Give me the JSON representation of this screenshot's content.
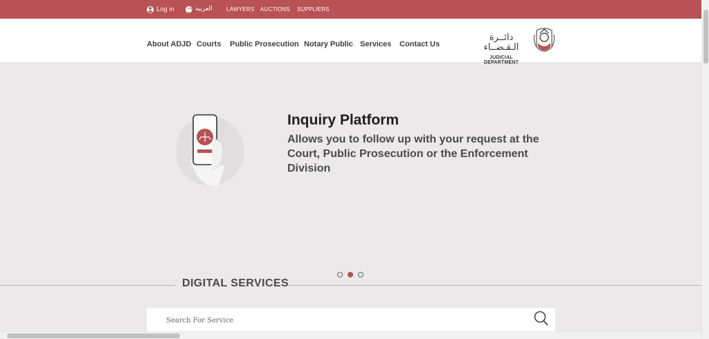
{
  "topbar": {
    "login": "Log in",
    "language": "العربية",
    "links": [
      "LAWYERS",
      "AUCTIONS",
      "SUPPLIERS"
    ]
  },
  "header": {
    "nav": [
      "About ADJD",
      "Courts",
      "Public Prosecution",
      "Notary Public",
      "Services",
      "Contact Us"
    ],
    "logo": {
      "arabic": "دائــرة الـقـضــاء",
      "english": "JUDICIAL DEPARTMENT"
    }
  },
  "hero": {
    "title": "Inquiry Platform",
    "description": "Allows you to follow up with your request at the Court, Public Prosecution or the Enforcement Division",
    "slides": 3,
    "active_slide": 2
  },
  "digital_services": {
    "title": "DIGITAL SERVICES",
    "search_placeholder": "Search For Service"
  },
  "colors": {
    "brand": "#b85254",
    "background": "#ebe9ea"
  }
}
